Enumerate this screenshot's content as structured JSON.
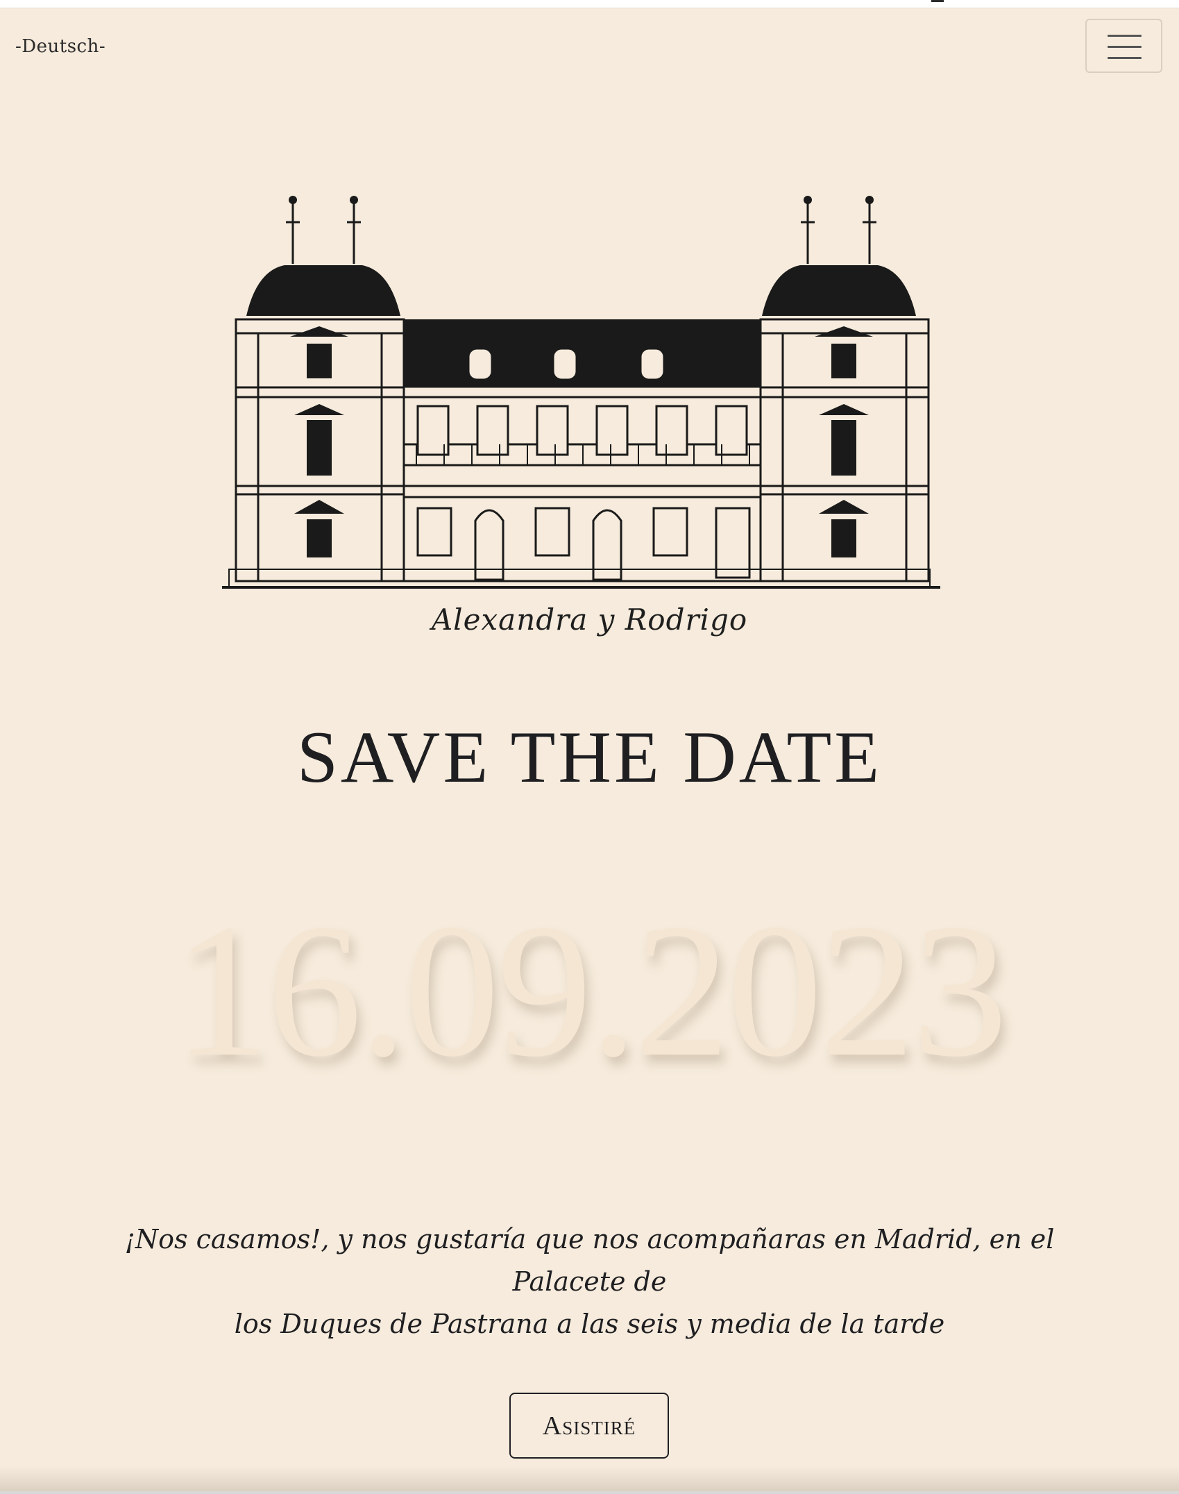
{
  "nav": {
    "language_link": "-Deutsch-",
    "menu_icon": "hamburger-menu-icon"
  },
  "hero": {
    "illustration": "palace-facade",
    "couple_names": "Alexandra y Rodrigo",
    "title": "SAVE THE DATE",
    "date": "16.09.2023"
  },
  "invitation": {
    "line1": "¡Nos casamos!, y nos gustaría que nos acompañaras en Madrid, en el Palacete de",
    "line2": "los Duques de Pastrana a las seis y media de la tarde"
  },
  "rsvp": {
    "button_label": "Asistiré"
  },
  "colors": {
    "background": "#f6ebdc",
    "text": "#1f1f22",
    "date_watermark": "#f4e6d3"
  }
}
